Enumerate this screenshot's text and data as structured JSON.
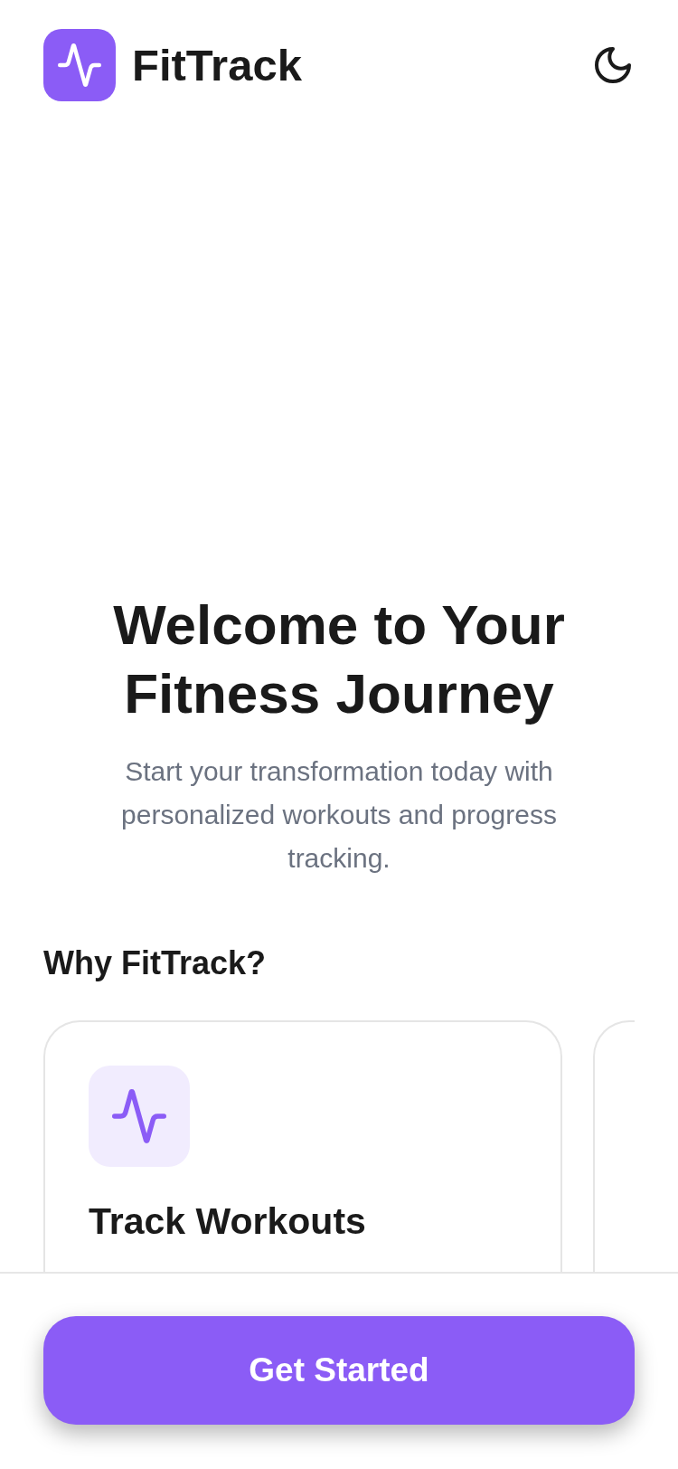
{
  "header": {
    "app_name": "FitTrack"
  },
  "hero": {
    "title": "Welcome to Your Fitness Journey",
    "subtitle": "Start your transformation today with personalized workouts and progress tracking."
  },
  "features": {
    "heading": "Why FitTrack?",
    "cards": [
      {
        "kind": "feature",
        "title": "Track Workouts"
      },
      {
        "kind": "cutoff"
      }
    ]
  },
  "cta": {
    "label": "Get Started"
  }
}
